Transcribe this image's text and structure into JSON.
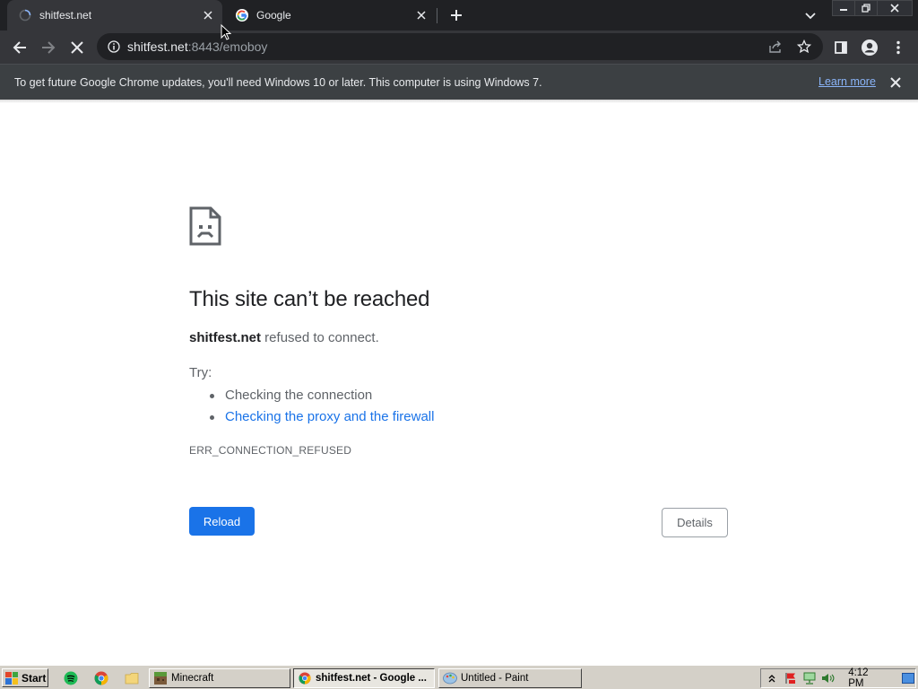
{
  "browser": {
    "tabs": [
      {
        "title": "shitfest.net",
        "active": true,
        "loading": true
      },
      {
        "title": "Google",
        "active": false,
        "favicon": "google-g-icon"
      }
    ],
    "url_host": "shitfest.net",
    "url_rest": ":8443/emoboy",
    "colors": {
      "frame": "#202124",
      "toolbar": "#35363a",
      "omnibox": "#202124"
    }
  },
  "infobar": {
    "message": "To get future Google Chrome updates, you'll need Windows 10 or later. This computer is using Windows 7.",
    "learn_more": "Learn more"
  },
  "error_page": {
    "title": "This site can’t be reached",
    "host": "shitfest.net",
    "description": " refused to connect.",
    "try_label": "Try:",
    "suggestions": [
      {
        "text": "Checking the connection",
        "link": false
      },
      {
        "text": "Checking the proxy and the firewall",
        "link": true
      }
    ],
    "error_code": "ERR_CONNECTION_REFUSED",
    "reload_label": "Reload",
    "details_label": "Details",
    "accent": "#1a73e8"
  },
  "taskbar": {
    "start_label": "Start",
    "tasks": [
      {
        "label": "Minecraft",
        "icon": "minecraft-icon",
        "active": false
      },
      {
        "label": "shitfest.net - Google ...",
        "icon": "chrome-icon",
        "active": true
      },
      {
        "label": "Untitled - Paint",
        "icon": "paint-icon",
        "active": false
      }
    ],
    "clock": "4:12 PM"
  }
}
